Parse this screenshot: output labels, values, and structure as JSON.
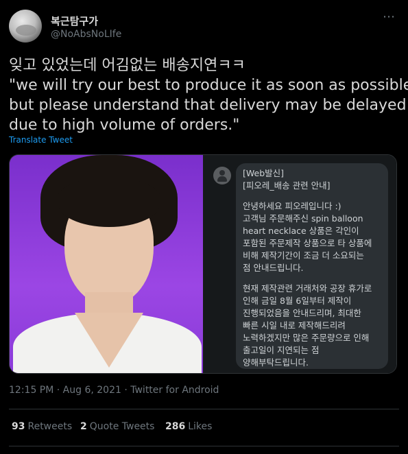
{
  "author": {
    "display_name": "복근탐구가",
    "handle": "@NoAbsNoLIfe"
  },
  "more_icon": "⋯",
  "tweet_text": {
    "line1": "잊고 있었는데 어김없는 배송지연ㅋㅋ",
    "line2": "\"we will try our best to produce it as soon as possible,",
    "line3": "but please understand that delivery may be delayed",
    "line4": "due to high volume of orders.\""
  },
  "translate_label": "Translate Tweet",
  "message": {
    "lines": [
      "[Web발신]",
      "[피오레_배송 관련 안내]",
      "",
      "안녕하세요 피오레입니다 :)",
      "고객님 주문해주신 spin balloon",
      "heart necklace 상품은 각인이",
      "포함된 주문제작 상품으로 타 상품에",
      "비해 제작기간이 조금 더 소요되는",
      "점 안내드립니다.",
      "",
      "현재 제작관련 거래처와 공장 휴가로",
      "인해 금일 8월 6일부터 제작이",
      "진행되었음을 안내드리며, 최대한",
      "빠른 시일 내로 제작해드리려",
      "노력하겠지만 많은 주문량으로 인해",
      "출고일이 지연되는 점",
      "양해부탁드립니다."
    ]
  },
  "meta": {
    "time": "12:15 PM · Aug 6, 2021 · Twitter for Android"
  },
  "stats": {
    "retweets_count": "93",
    "retweets_label": "Retweets",
    "quotes_count": "2",
    "quotes_label": "Quote Tweets",
    "likes_count": "286",
    "likes_label": "Likes"
  }
}
